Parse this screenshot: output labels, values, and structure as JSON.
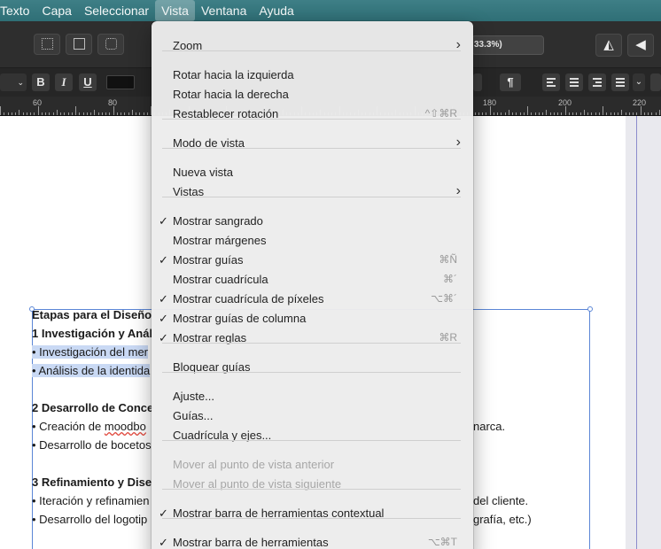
{
  "menubar": {
    "items": [
      "Texto",
      "Capa",
      "Seleccionar",
      "Vista",
      "Ventana",
      "Ayuda"
    ]
  },
  "toolbar": {
    "zoom_text": "33.3%)",
    "bold": "B",
    "italic": "I",
    "underline": "U",
    "pilcrow": "¶"
  },
  "ruler": {
    "labels": [
      "60",
      "80",
      "180",
      "200",
      "220"
    ]
  },
  "document": {
    "lines": [
      "Etapas para el Diseño",
      "1 Investigación y Anál",
      "• Investigación del mer",
      "• Análisis de la identida",
      "2 Desarrollo de Conce",
      "• Creación de ",
      "moodbo",
      "• Desarrollo de bocetos",
      "3 Refinamiento y Dise",
      "• Iteración y refinamien",
      "• Desarrollo del logotip"
    ],
    "right_fragments": [
      "narca.",
      "del cliente.",
      "grafía, etc.)"
    ]
  },
  "menu": {
    "items": [
      {
        "label": "Zoom",
        "submenu": true
      },
      {
        "label": "Rotar hacia la izquierda"
      },
      {
        "label": "Rotar hacia la derecha"
      },
      {
        "label": "Restablecer rotación",
        "shortcut": "^⇧⌘R"
      },
      {
        "label": "Modo de vista",
        "submenu": true
      },
      {
        "label": "Nueva vista"
      },
      {
        "label": "Vistas",
        "submenu": true
      },
      {
        "label": "Mostrar sangrado",
        "checked": true
      },
      {
        "label": "Mostrar márgenes"
      },
      {
        "label": "Mostrar guías",
        "checked": true,
        "shortcut": "⌘Ñ"
      },
      {
        "label": "Mostrar cuadrícula",
        "shortcut": "⌘´"
      },
      {
        "label": "Mostrar cuadrícula de píxeles",
        "checked": true,
        "shortcut": "⌥⌘´"
      },
      {
        "label": "Mostrar guías de columna",
        "checked": true
      },
      {
        "label": "Mostrar reglas",
        "checked": true,
        "shortcut": "⌘R"
      },
      {
        "label": "Bloquear guías"
      },
      {
        "label": "Ajuste..."
      },
      {
        "label": "Guías..."
      },
      {
        "label": "Cuadrícula y ejes..."
      },
      {
        "label": "Mover al punto de vista anterior",
        "disabled": true
      },
      {
        "label": "Mover al punto de vista siguiente",
        "disabled": true
      },
      {
        "label": "Mostrar barra de herramientas contextual",
        "checked": true
      },
      {
        "label": "Mostrar barra de herramientas",
        "checked": true,
        "shortcut": "⌥⌘T"
      }
    ],
    "check_glyph": "✓",
    "submenu_glyph": "›"
  }
}
